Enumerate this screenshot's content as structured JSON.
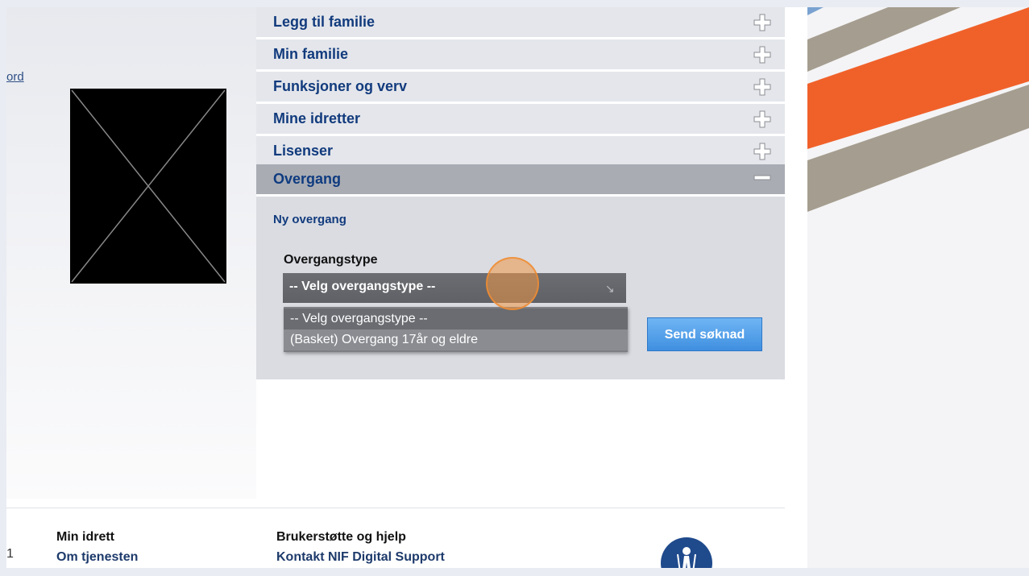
{
  "left": {
    "link_fragment": "ord"
  },
  "accordion": [
    {
      "label": "Legg til familie"
    },
    {
      "label": "Min familie"
    },
    {
      "label": "Funksjoner og verv"
    },
    {
      "label": "Mine idretter"
    },
    {
      "label": "Lisenser"
    }
  ],
  "open_section": {
    "label": "Overgang",
    "subtitle": "Ny overgang",
    "field_label": "Overgangstype",
    "select_value": "-- Velg overgangstype --",
    "options": [
      "-- Velg overgangstype --",
      "(Basket) Overgang 17år og eldre"
    ],
    "submit_label": "Send søknad"
  },
  "footer": {
    "col1_heading": "Min idrett",
    "col1_link": "Om tjenesten",
    "col2_heading": "Brukerstøtte og hjelp",
    "col2_link": "Kontakt NIF Digital Support",
    "left_fragment": "1"
  },
  "colors": {
    "accent_blue": "#123b7d",
    "button_blue": "#4f9de8",
    "deco_orange": "#f0612a",
    "deco_taupe": "#a59d8f"
  }
}
